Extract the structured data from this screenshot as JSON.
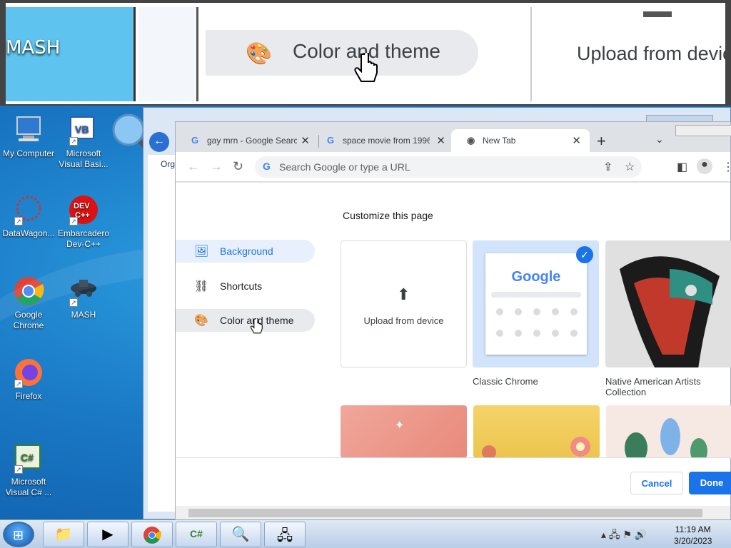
{
  "magnifier": {
    "left_text": "MASH",
    "pill_text": "Color and theme",
    "right_text": "Upload from device"
  },
  "desktop_icons": [
    {
      "label": "My Computer"
    },
    {
      "label": "Microsoft Visual Basi..."
    },
    {
      "label": "DataWagon..."
    },
    {
      "label": "Embarcadero Dev-C++"
    },
    {
      "label": "Google Chrome"
    },
    {
      "label": "MASH"
    },
    {
      "label": "Firefox"
    },
    {
      "label": "Microsoft Visual C# ..."
    }
  ],
  "explorer": {
    "org_label": "Org"
  },
  "chrome": {
    "tabs": [
      {
        "title": "gay mrn - Google Searc"
      },
      {
        "title": "space movie from 1996"
      },
      {
        "title": "New Tab"
      }
    ],
    "omnibox_placeholder": "Search Google or type a URL",
    "dialog": {
      "title": "Customize this page",
      "menu": [
        {
          "label": "Background",
          "icon": "image-icon",
          "selected": true
        },
        {
          "label": "Shortcuts",
          "icon": "link-icon",
          "selected": false
        },
        {
          "label": "Color and theme",
          "icon": "palette-icon",
          "selected": false
        }
      ],
      "tiles": {
        "upload": "Upload from device",
        "classic": "Classic Chrome",
        "native": "Native American Artists Collection",
        "google_logo": "Google"
      },
      "cancel": "Cancel",
      "done": "Done"
    }
  },
  "taskbar": {
    "time": "11:19 AM",
    "date": "3/20/2023"
  }
}
